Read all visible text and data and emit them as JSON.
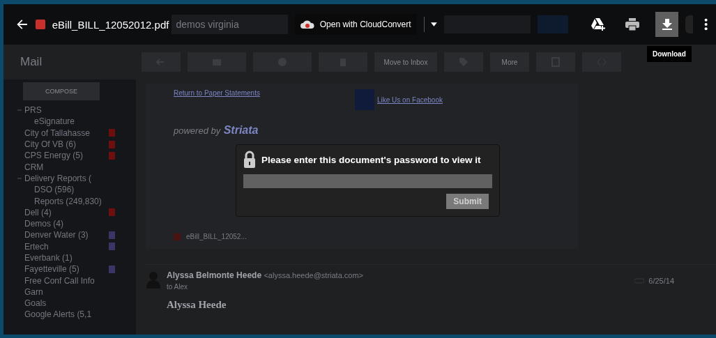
{
  "viewer": {
    "file_name": "eBill_BILL_12052012.pdf",
    "open_with": "Open with CloudConvert",
    "tooltip": "Download",
    "actions": [
      {
        "kind": "drive",
        "selected": false
      },
      {
        "kind": "print",
        "selected": false
      },
      {
        "kind": "download",
        "selected": true
      }
    ]
  },
  "gmail": {
    "search": "demos virginia",
    "app_menu": "Mail",
    "compose": "COMPOSE",
    "move_to_inbox": "Move to Inbox",
    "more": "More",
    "sidebar": [
      {
        "label": "PRS",
        "children": [
          {
            "label": "eSignature"
          }
        ]
      },
      {
        "label": "City of Tallahasse",
        "color": "#6e0f0f"
      },
      {
        "label": "City Of VB (6)",
        "color": "#6e0f0f"
      },
      {
        "label": "CPS Energy (5)",
        "color": "#6e0f0f"
      },
      {
        "label": "CRM"
      },
      {
        "label": "Delivery Reports (",
        "children": [
          {
            "label": "DSO (596)"
          },
          {
            "label": "Reports (249,830)"
          }
        ]
      },
      {
        "label": "Dell (4)",
        "color": "#6e0f0f"
      },
      {
        "label": "Demos (4)"
      },
      {
        "label": "Denver Water (3)",
        "color": "#3a3566"
      },
      {
        "label": "Ertech",
        "color": "#3a3566"
      },
      {
        "label": "Everbank (1)"
      },
      {
        "label": "Fayetteville (5)",
        "color": "#3a3566"
      },
      {
        "label": "Free Conf Call Info"
      },
      {
        "label": "Garn"
      },
      {
        "label": "Goals"
      },
      {
        "label": "Google Alerts (5,1"
      }
    ],
    "message": {
      "return_link": "Return to Paper Statements",
      "facebook": "Like Us on Facebook",
      "powered_by": "powered by",
      "brand": "Striata",
      "attachment": "eBill_BILL_12052...",
      "sender": "Alyssa Belmonte Heede",
      "sender_email": "<alyssa.heede@striata.com>",
      "to": "to Alex",
      "date": "6/25/14",
      "signature": "Alyssa Heede"
    }
  },
  "dialog": {
    "prompt": "Please enter this document's password to view it",
    "submit": "Submit"
  }
}
